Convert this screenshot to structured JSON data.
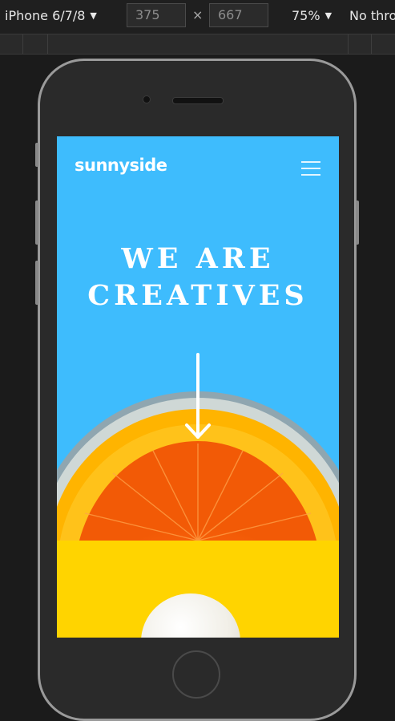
{
  "devtools": {
    "device_name": "iPhone 6/7/8",
    "width_value": "375",
    "height_value": "667",
    "times_symbol": "×",
    "zoom": "75%",
    "throttling": "No thro"
  },
  "site": {
    "logo": "sunnyside",
    "headline_line1": "WE ARE",
    "headline_line2": "CREATIVES"
  },
  "icons": {
    "menu": "hamburger-icon",
    "arrow": "arrow-down-icon",
    "caret": "caret-down-icon"
  },
  "colors": {
    "hero_blue": "#3ebcfd",
    "yellow": "#ffd400",
    "orange": "#ff7a1a",
    "text": "#ffffff"
  }
}
